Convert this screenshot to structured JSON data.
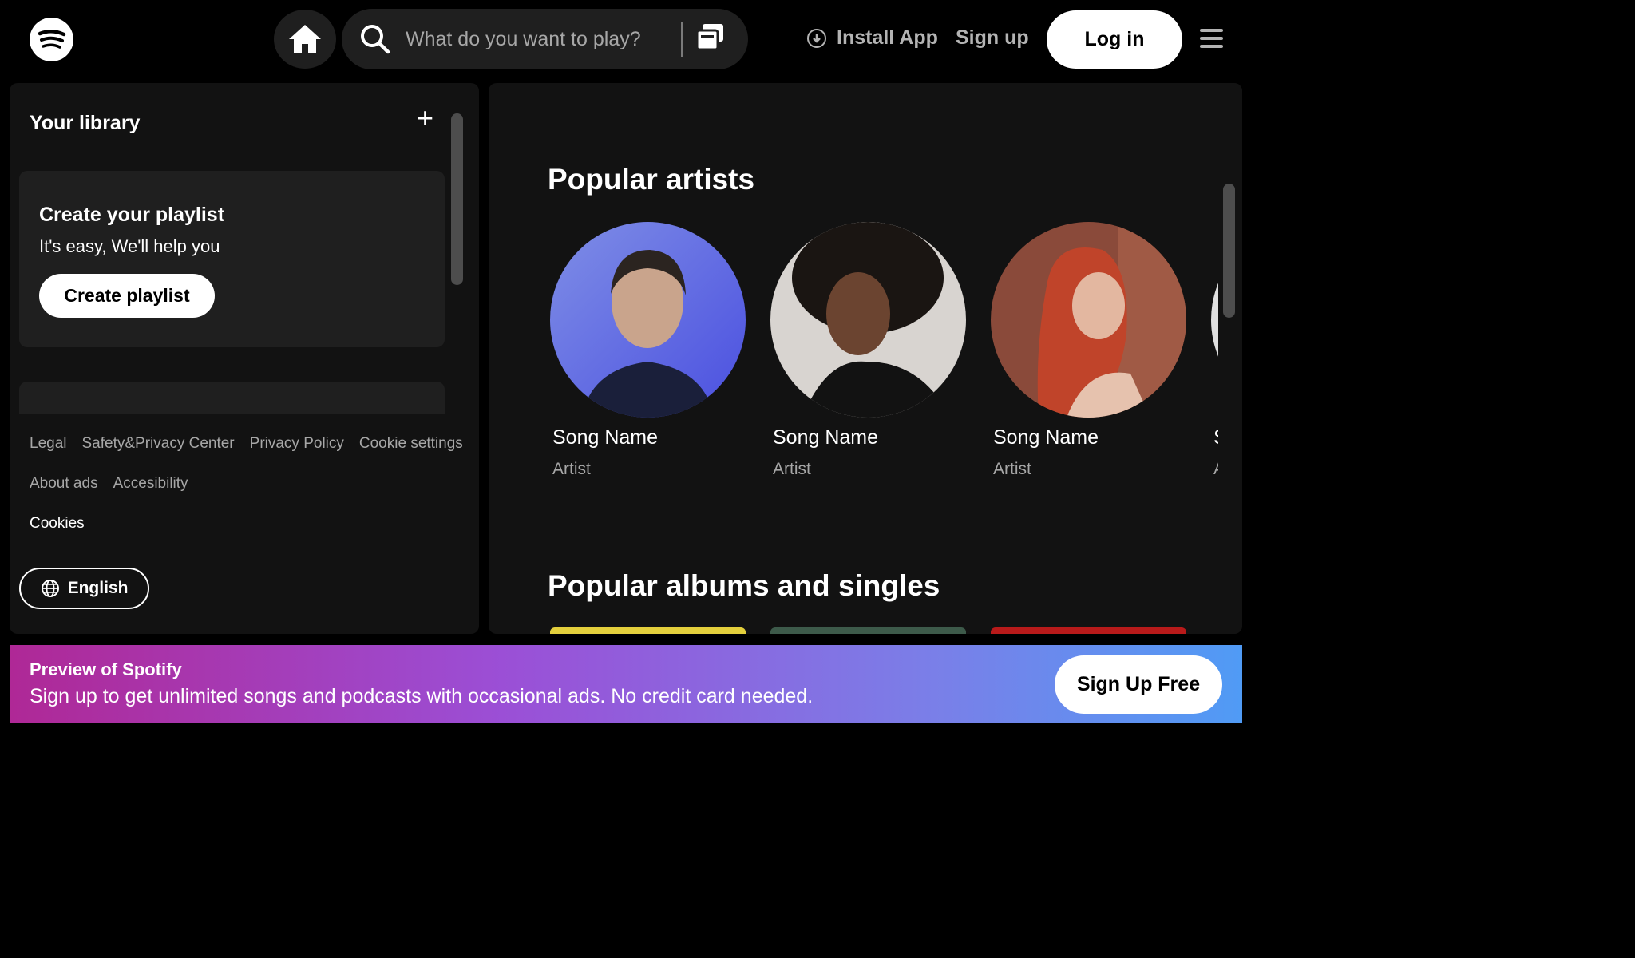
{
  "header": {
    "search_placeholder": "What do you want to play?",
    "install_label": "Install App",
    "signup_label": "Sign up",
    "login_label": "Log in"
  },
  "sidebar": {
    "title": "Your library",
    "add_icon": "+",
    "card": {
      "title": "Create your playlist",
      "subtitle": "It's easy, We'll help you",
      "button": "Create playlist"
    },
    "footer_links_row1": [
      "Legal",
      "Safety&Privacy Center",
      "Privacy Policy",
      "Cookie settings"
    ],
    "footer_links_row2": [
      "About ads",
      "Accesibility"
    ],
    "cookies": "Cookies",
    "language": "English"
  },
  "main": {
    "popular_artists_title": "Popular artists",
    "artists": [
      {
        "name": "Song Name",
        "role": "Artist"
      },
      {
        "name": "Song Name",
        "role": "Artist"
      },
      {
        "name": "Song Name",
        "role": "Artist"
      },
      {
        "name": "S",
        "role": "A"
      }
    ],
    "popular_albums_title": "Popular albums and singles"
  },
  "banner": {
    "title": "Preview of Spotify",
    "text": "Sign up to get unlimited songs and podcasts with occasional ads. No credit card needed.",
    "button": "Sign Up Free"
  },
  "colors": {
    "background": "#000000",
    "panel": "#121212",
    "card": "#1f1f1f",
    "muted_text": "#a7a7a7",
    "banner_start": "#af2896",
    "banner_end": "#509bf5"
  },
  "icons": [
    "spotify-logo-icon",
    "home-icon",
    "search-icon",
    "browse-icon",
    "download-icon",
    "menu-icon",
    "plus-icon",
    "globe-icon"
  ]
}
